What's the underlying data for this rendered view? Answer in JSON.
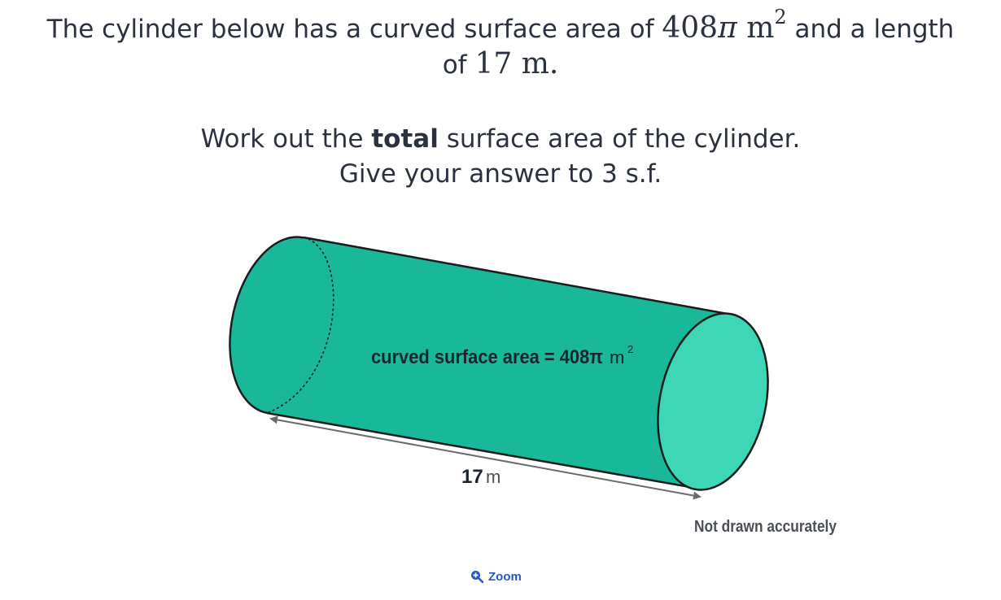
{
  "question": {
    "line1_prefix": "The cylinder below has a curved surface area of",
    "line1_value": "408",
    "line1_pi": "π",
    "line1_unit": "m",
    "line1_unit_exp": "2",
    "line1_suffix": "and a length",
    "line2_prefix": "of",
    "line2_value": "17",
    "line2_unit": "m.",
    "line3_prefix": "Work out the",
    "line3_bold": "total",
    "line3_suffix": "surface area of the cylinder.",
    "line4": "Give your answer to 3 s.f."
  },
  "diagram": {
    "label_csa_text": "curved surface area = 408π",
    "label_csa_unit": "m",
    "label_csa_exp": "2",
    "label_length_value": "17",
    "label_length_unit": "m",
    "note": "Not drawn accurately",
    "colors": {
      "cylinder_body": "#1ab89b",
      "cylinder_end": "#3dd6b6",
      "outline": "#1c1c1c",
      "arrow": "#6b6b6b",
      "label_text": "#1c2430",
      "note_text": "#4a4f55"
    }
  },
  "zoom": {
    "label": "Zoom",
    "icon": "zoom-in-icon",
    "color": "#2655c4"
  }
}
